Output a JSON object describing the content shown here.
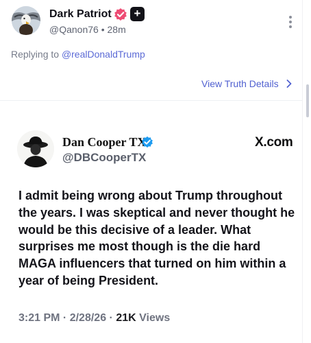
{
  "post": {
    "author_name": "Dark Patriot",
    "author_handle": "@Qanon76",
    "time_ago": "28m",
    "reply_prefix": "Replying to",
    "reply_to": "@realDonaldTrump",
    "view_details_label": "View Truth Details"
  },
  "embed": {
    "author_name": "Dan Cooper TX",
    "author_handle": "@DBCooperTX",
    "source": "X.com",
    "body": "I admit being wrong about Trump throughout the years. I was skeptical and never thought he would be this decisive of a leader. What surprises me most though is the die hard MAGA influencers that turned on him within a year of being President.",
    "time": "3:21 PM",
    "date": "2/28/26",
    "views_count": "21K",
    "views_label": "Views"
  },
  "colors": {
    "link": "#5060d0",
    "verified_pink": "#ee4c74",
    "verified_blue": "#1d9bf0"
  },
  "icons": {
    "verified": "verified-badge-icon",
    "plus": "plus-badge-icon",
    "more": "more-vertical-icon",
    "chevron": "chevron-right-icon"
  }
}
